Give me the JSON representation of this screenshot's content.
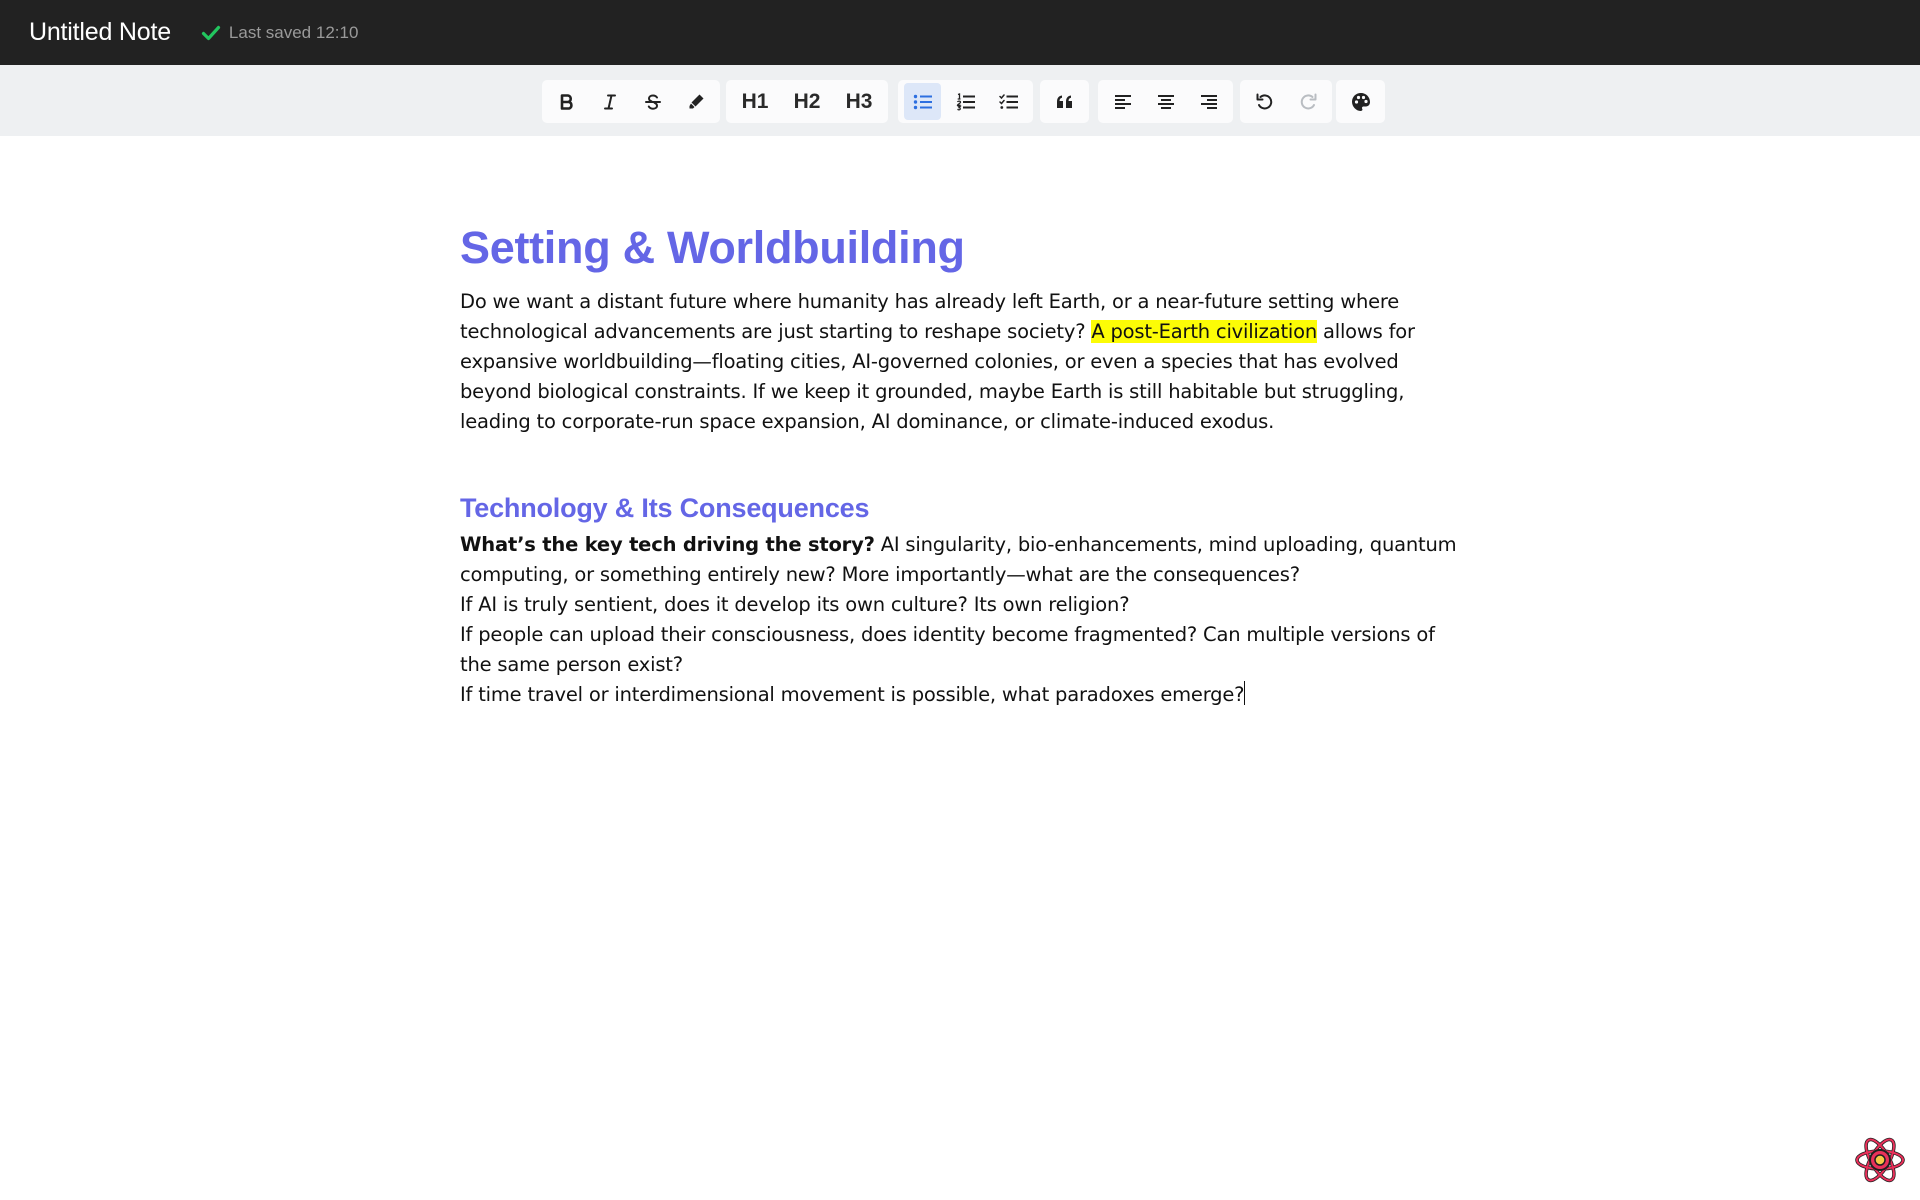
{
  "header": {
    "title": "Untitled Note",
    "save_status": "Last saved 12:10",
    "save_icon": "check-icon",
    "save_icon_color": "#22c55e"
  },
  "toolbar": {
    "text_format": [
      "bold-icon",
      "italic-icon",
      "strikethrough-icon",
      "highlighter-icon"
    ],
    "headings": [
      "H1",
      "H2",
      "H3"
    ],
    "lists": [
      "bullet-list-icon",
      "ordered-list-icon",
      "task-list-icon"
    ],
    "active_button": "bullet-list-icon",
    "quote": "blockquote-icon",
    "align": [
      "align-left-icon",
      "align-center-icon",
      "align-right-icon"
    ],
    "history": [
      "undo-icon",
      "redo-icon"
    ],
    "redo_disabled": true,
    "theme": "palette-icon"
  },
  "document": {
    "heading1": "Setting & Worldbuilding",
    "para1_before": "Do we want a distant future where humanity has already left Earth, or a near-future setting where technological advancements are just starting to reshape society?",
    "para1_highlight": "A post-Earth civilization",
    "para1_after": "allows for expansive worldbuilding—floating cities, AI-governed colonies, or even a species that has evolved beyond biological constraints. If we keep it grounded, maybe Earth is still habitable but struggling, leading to corporate-run space expansion, AI dominance, or climate-induced exodus.",
    "heading2": "Technology & Its Consequences",
    "para2_bold": "What’s the key tech driving the story?",
    "para2_rest": "AI singularity, bio-enhancements, mind uploading, quantum computing, or something entirely new? More importantly—what are the consequences?",
    "line3": "If AI is truly sentient, does it develop its own culture? Its own religion?",
    "line4": "If people can upload their consciousness, does identity become fragmented? Can multiple versions of the same person exist?",
    "line5": "If time travel or interdimensional movement is possible, what paradoxes emerge?",
    "heading_color": "#6466e6",
    "highlight_color": "#fcfc06"
  },
  "corner_badge": "react-logo-icon"
}
